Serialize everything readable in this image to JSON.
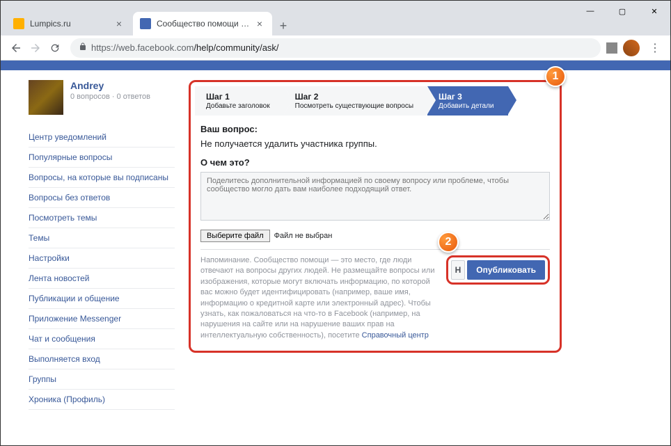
{
  "browser": {
    "tabs": [
      {
        "title": "Lumpics.ru",
        "active": false
      },
      {
        "title": "Сообщество помощи Facebook",
        "active": true
      }
    ],
    "url_proto": "https://",
    "url_host": "web.facebook.com",
    "url_path": "/help/community/ask/",
    "win_min": "—",
    "win_max": "▢",
    "win_close": "✕",
    "new_tab": "+"
  },
  "profile": {
    "name": "Andrey",
    "stats": "0 вопросов · 0 ответов"
  },
  "sidebar": {
    "items": [
      "Центр уведомлений",
      "Популярные вопросы",
      "Вопросы, на которые вы подписаны",
      "Вопросы без ответов",
      "Посмотреть темы",
      "Темы",
      "Настройки",
      "Лента новостей",
      "Публикации и общение",
      "Приложение Messenger",
      "Чат и сообщения",
      "Выполняется вход",
      "Группы",
      "Хроника (Профиль)"
    ]
  },
  "steps": [
    {
      "title": "Шаг 1",
      "sub": "Добавьте заголовок"
    },
    {
      "title": "Шаг 2",
      "sub": "Посмотреть существующие вопросы"
    },
    {
      "title": "Шаг 3",
      "sub": "Добавить детали"
    }
  ],
  "form": {
    "question_label": "Ваш вопрос:",
    "question_text": "Не получается удалить участника группы.",
    "about_label": "О чем это?",
    "textarea_placeholder": "Поделитесь дополнительной информацией по своему вопросу или проблеме, чтобы сообщество могло дать вам наиболее подходящий ответ.",
    "file_button": "Выберите файл",
    "file_status": "Файл не выбран",
    "reminder_text": "Напоминание. Сообщество помощи — это место, где люди отвечают на вопросы других людей. Не размещайте вопросы или изображения, которые могут включать информацию, по которой вас можно будет идентифицировать (например, ваше имя, информацию о кредитной карте или электронный адрес). Чтобы узнать, как пожаловаться на что-то в Facebook (например, на нарушения на сайте или на нарушение ваших прав на интеллектуальную собственность), посетите ",
    "reminder_link": "Справочный центр",
    "cancel_label": "Н",
    "publish_label": "Опубликовать"
  },
  "callouts": {
    "one": "1",
    "two": "2"
  }
}
